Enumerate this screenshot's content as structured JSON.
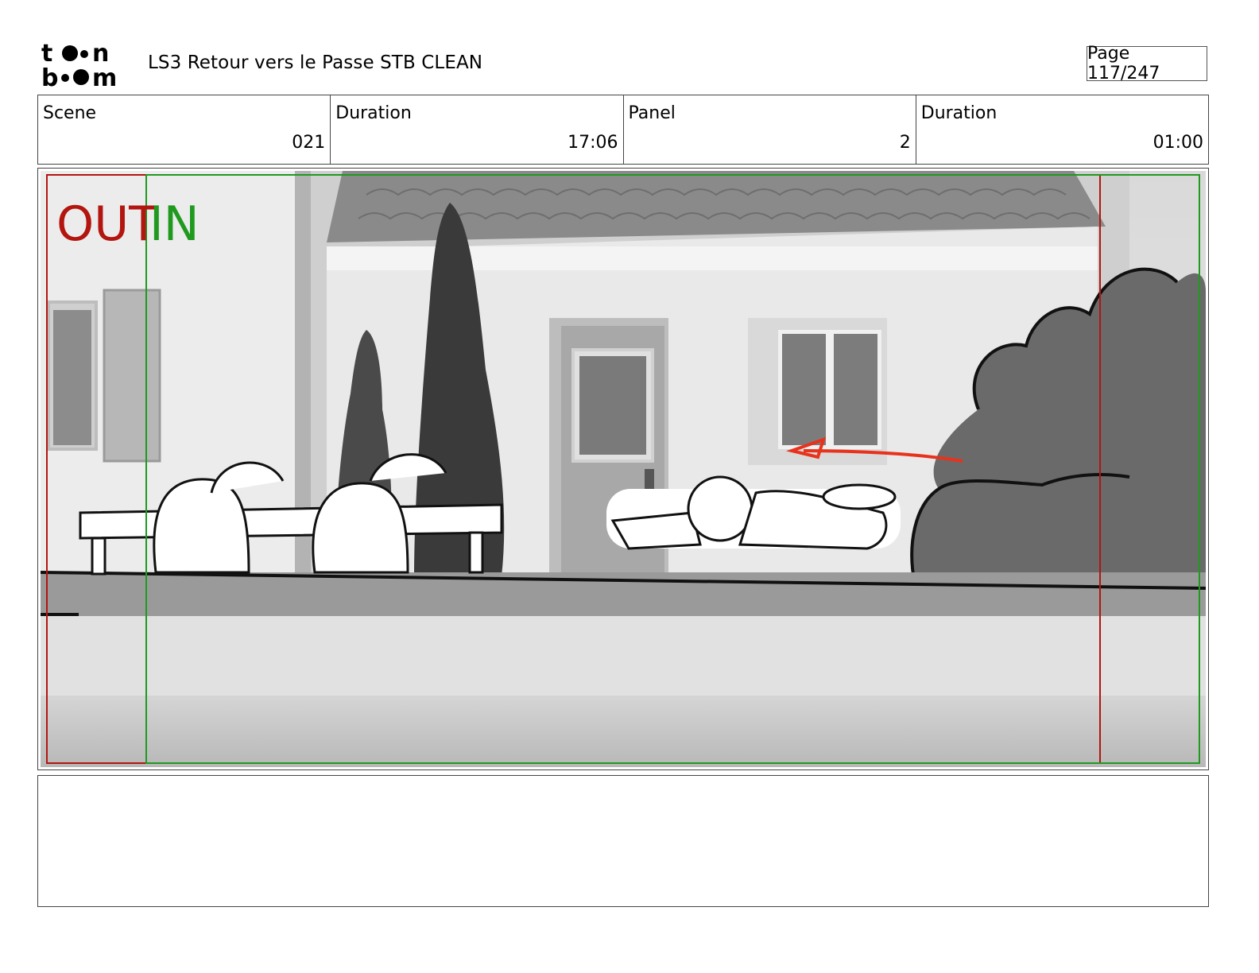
{
  "header": {
    "logo": {
      "line1": "toon",
      "line2": "boom"
    },
    "document_title": "LS3 Retour vers le Passe STB CLEAN",
    "page": "Page 117/247"
  },
  "info": {
    "scene_label": "Scene",
    "scene_value": "021",
    "scene_duration_label": "Duration",
    "scene_duration_value": "17:06",
    "panel_label": "Panel",
    "panel_value": "2",
    "panel_duration_label": "Duration",
    "panel_duration_value": "01:00"
  },
  "panel": {
    "out_marker": "OUT",
    "in_marker": "IN",
    "colors": {
      "out": "#b3150f",
      "in": "#1f9a1f",
      "action_arrow": "#e8321c"
    }
  },
  "notes": {
    "text": ""
  }
}
